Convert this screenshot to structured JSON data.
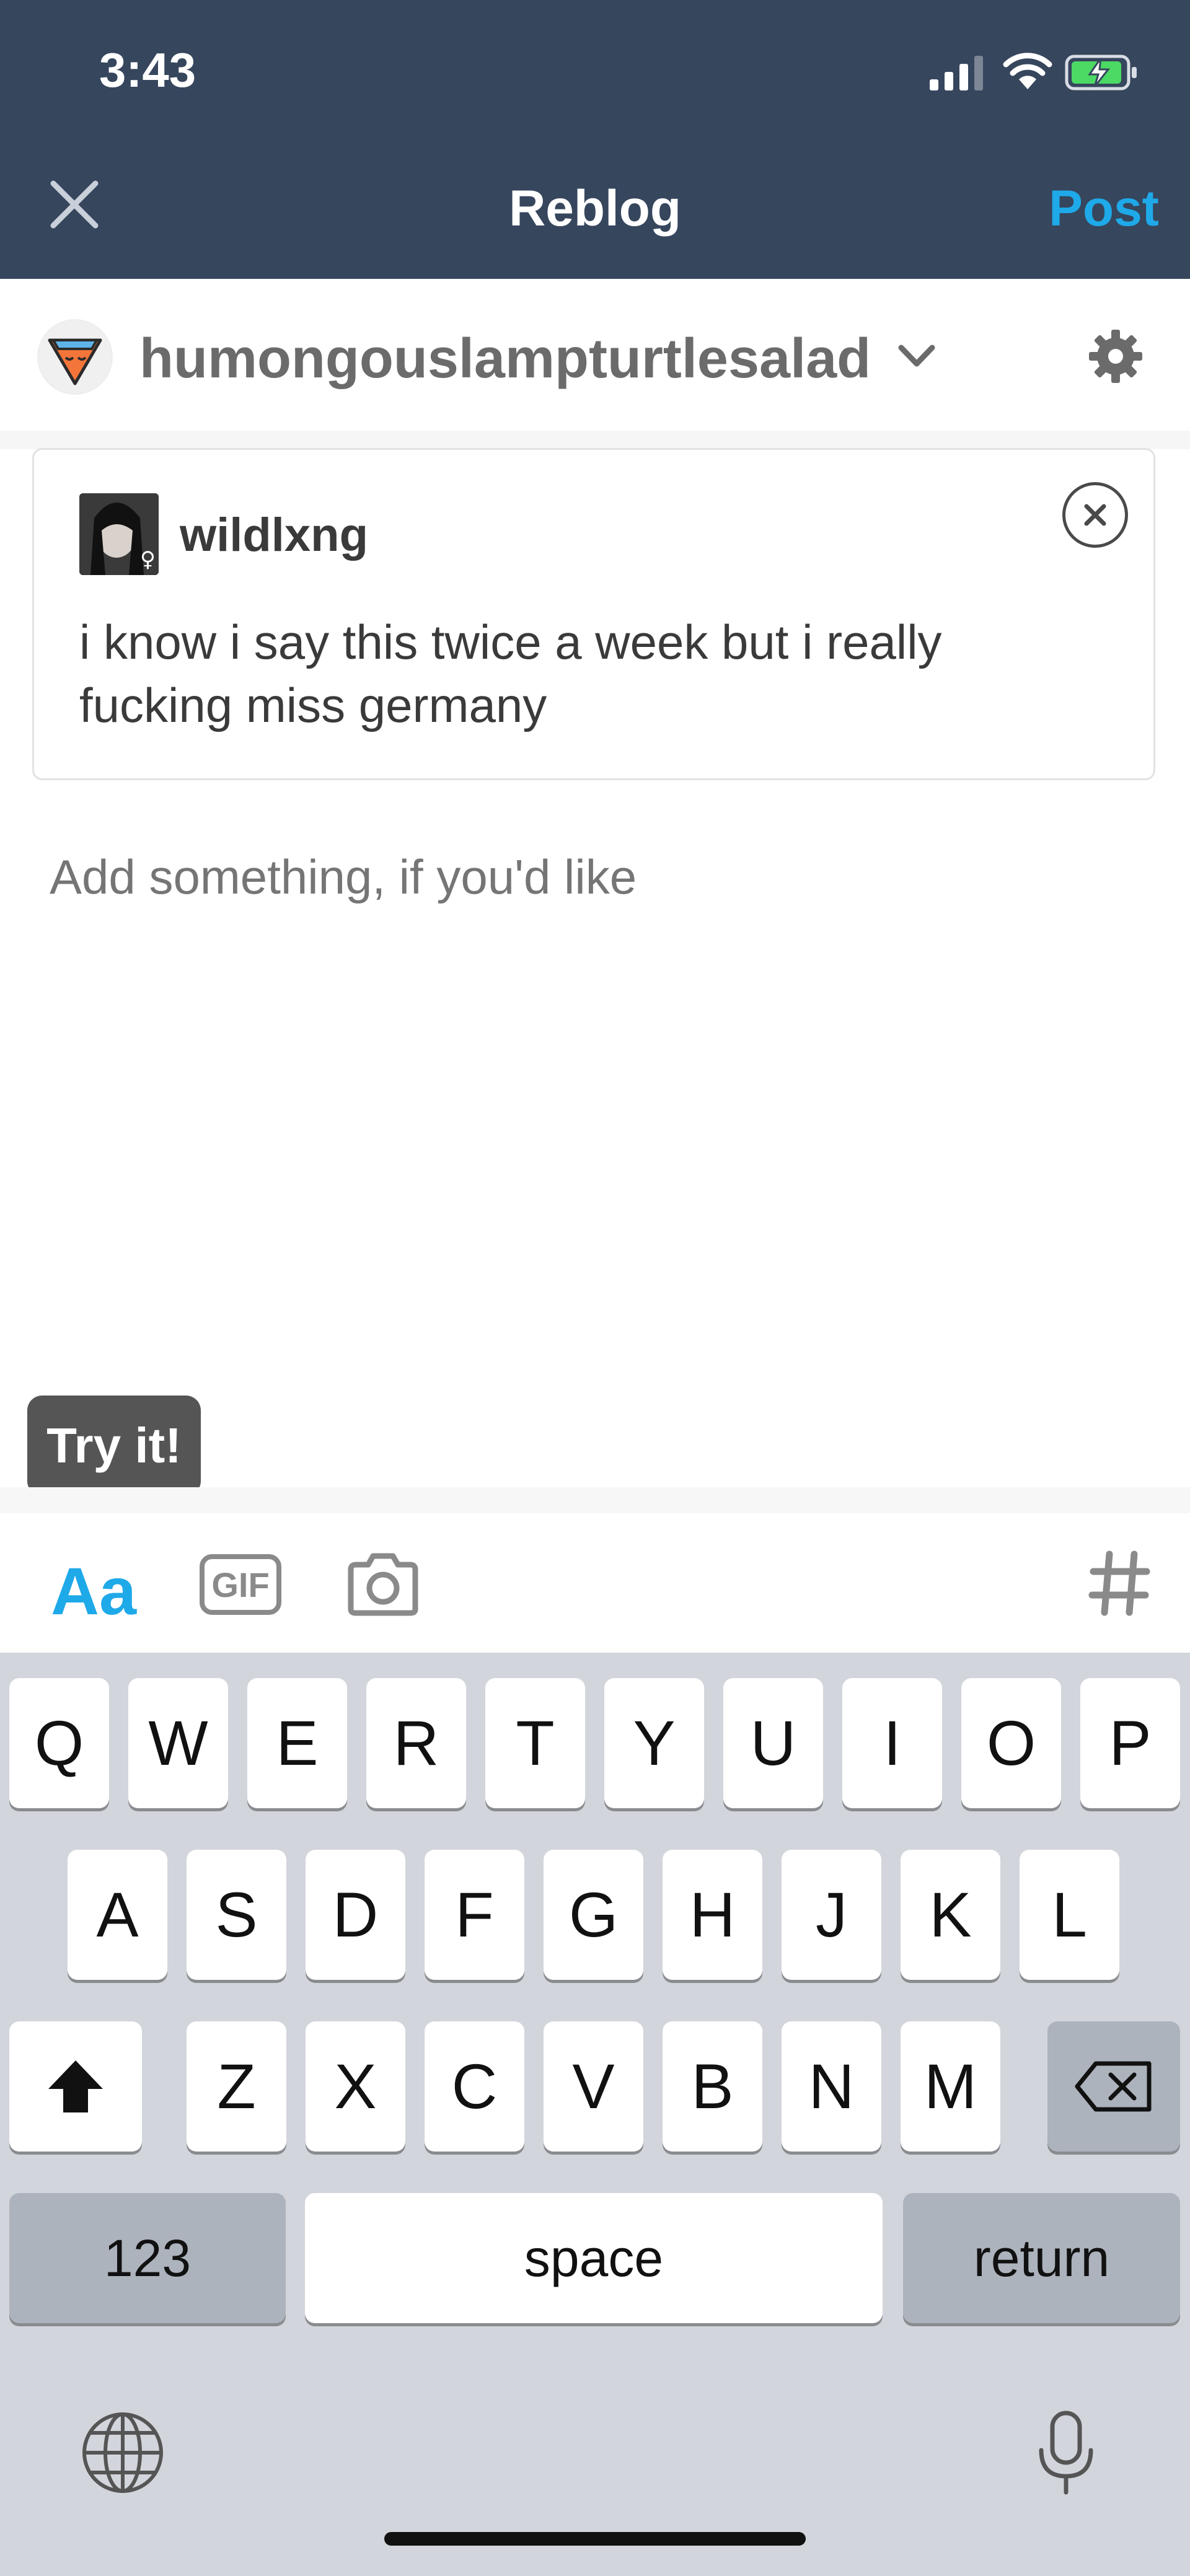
{
  "status_bar": {
    "time": "3:43"
  },
  "header": {
    "close_icon": "close-icon",
    "title": "Reblog",
    "post_label": "Post"
  },
  "blog": {
    "name": "humongouslampturtlesalad"
  },
  "reblog_card": {
    "username": "wildlxng",
    "text": "i know i say this twice a week but i really fucking miss germany"
  },
  "compose": {
    "placeholder": "Add something, if you'd like"
  },
  "tooltip": {
    "text": "Try it!"
  },
  "toolbar": {
    "text_label": "Aa",
    "gif_label": "GIF"
  },
  "keyboard": {
    "row1": [
      "Q",
      "W",
      "E",
      "R",
      "T",
      "Y",
      "U",
      "I",
      "O",
      "P"
    ],
    "row2": [
      "A",
      "S",
      "D",
      "F",
      "G",
      "H",
      "J",
      "K",
      "L"
    ],
    "row3": [
      "Z",
      "X",
      "C",
      "V",
      "B",
      "N",
      "M"
    ],
    "numbers_label": "123",
    "space_label": "space",
    "return_label": "return"
  },
  "colors": {
    "nav_bg": "#36465d",
    "accent": "#1ea9e9",
    "keyboard_bg": "#d2d5db"
  }
}
